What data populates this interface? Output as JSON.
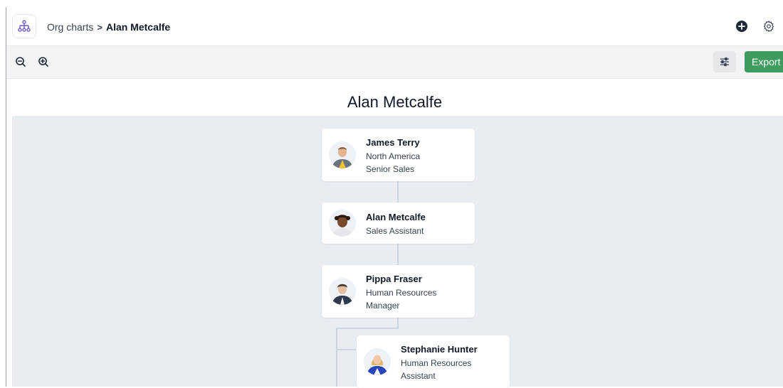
{
  "header": {
    "breadcrumb_root": "Org charts",
    "breadcrumb_separator": ">",
    "breadcrumb_current": "Alan Metcalfe",
    "logo_icon": "org-chart-icon",
    "add_icon": "plus-circle-icon",
    "settings_icon": "gear-icon"
  },
  "toolbar": {
    "zoom_out_icon": "zoom-out-icon",
    "zoom_in_icon": "zoom-in-icon",
    "filter_icon": "sliders-icon",
    "export_label": "Export"
  },
  "chart": {
    "title": "Alan Metcalfe",
    "cards": [
      {
        "name": "James Terry",
        "line1": "North America",
        "line2": "Senior Sales"
      },
      {
        "name": "Alan Metcalfe",
        "line1": "Sales Assistant",
        "line2": ""
      },
      {
        "name": "Pippa Fraser",
        "line1": "Human Resources",
        "line2": "Manager"
      },
      {
        "name": "Stephanie Hunter",
        "line1": "Human Resources",
        "line2": "Assistant"
      }
    ]
  },
  "colors": {
    "accent_green": "#3f9c5f",
    "canvas_bg": "#e9edf2",
    "logo_purple": "#6d5bd0"
  }
}
